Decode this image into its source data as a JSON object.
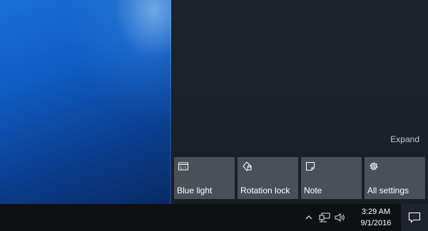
{
  "action_center": {
    "expand_label": "Expand",
    "quick_actions": [
      {
        "label": "Blue light",
        "icon": "blue-light-icon"
      },
      {
        "label": "Rotation lock",
        "icon": "rotation-lock-icon"
      },
      {
        "label": "Note",
        "icon": "note-icon"
      },
      {
        "label": "All settings",
        "icon": "gear-icon"
      }
    ]
  },
  "taskbar": {
    "tray_icons": [
      "chevron-up-icon",
      "network-icon",
      "volume-icon"
    ],
    "time": "3:29 AM",
    "date": "9/1/2016",
    "notification_icon": "action-center-icon"
  },
  "colors": {
    "desktop_blue": "#0f5cc2",
    "action_center_bg": "#1b232b",
    "tile_bg": "#4a5058",
    "taskbar_bg": "#0e1014"
  }
}
